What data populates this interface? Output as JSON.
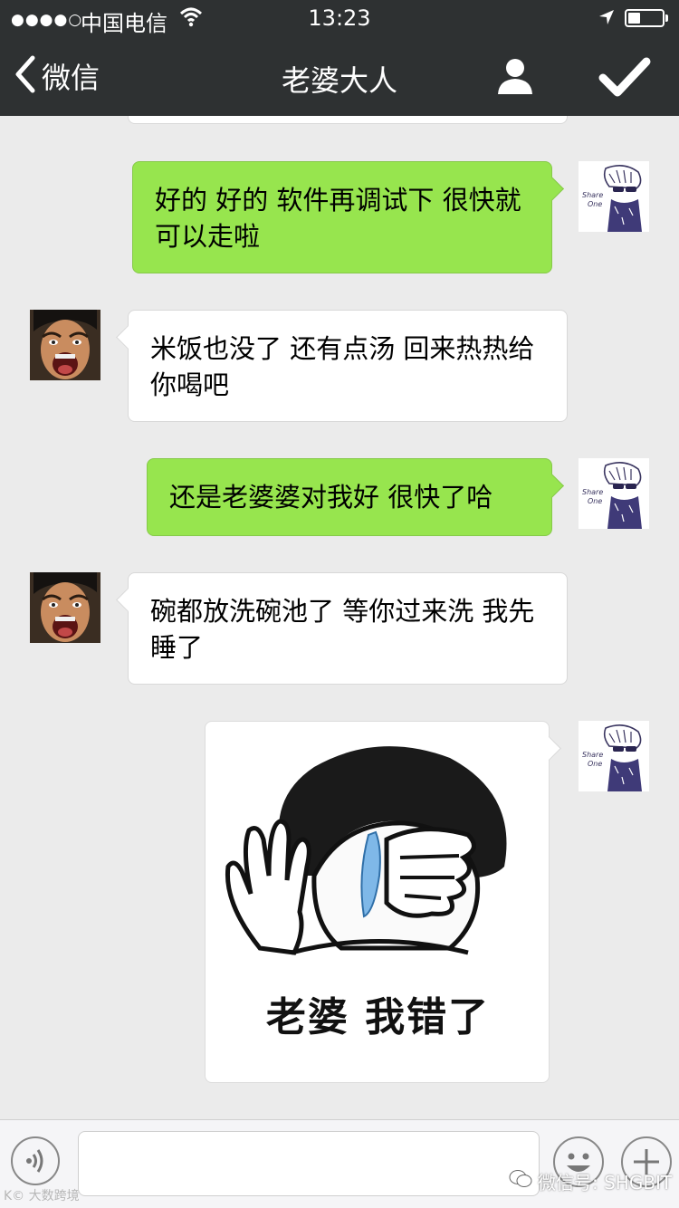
{
  "status_bar": {
    "signal": "●●●●○",
    "carrier": "中国电信",
    "time": "13:23",
    "battery_level": 0.35,
    "icons": [
      "wifi-icon",
      "location-arrow-icon",
      "battery-icon"
    ]
  },
  "nav": {
    "back_label": "微信",
    "title": "老婆大人",
    "icons": [
      "chevron-left-icon",
      "person-icon",
      "checkmark-icon"
    ]
  },
  "messages": [
    {
      "side": "out",
      "text": "好的 好的 软件再调试下 很快就可以走啦"
    },
    {
      "side": "in",
      "text": "米饭也没了 还有点汤 回来热热给你喝吧"
    },
    {
      "side": "out",
      "text": "还是老婆婆对我好 很快了哈"
    },
    {
      "side": "in",
      "text": "碗都放洗碗池了 等你过来洗 我先睡了"
    },
    {
      "side": "out",
      "type": "sticker",
      "caption": "老婆 我错了"
    }
  ],
  "avatars": {
    "self_label": "Share One"
  },
  "input_bar": {
    "placeholder": "",
    "icons": [
      "voice-icon",
      "emoji-icon",
      "plus-icon"
    ]
  },
  "watermarks": {
    "left": "K© 大数跨境",
    "right": "微信号: SHGBIT"
  },
  "colors": {
    "nav_bg": "#2e3132",
    "chat_bg": "#ebebeb",
    "out_bubble": "#97e54e",
    "in_bubble": "#ffffff"
  }
}
